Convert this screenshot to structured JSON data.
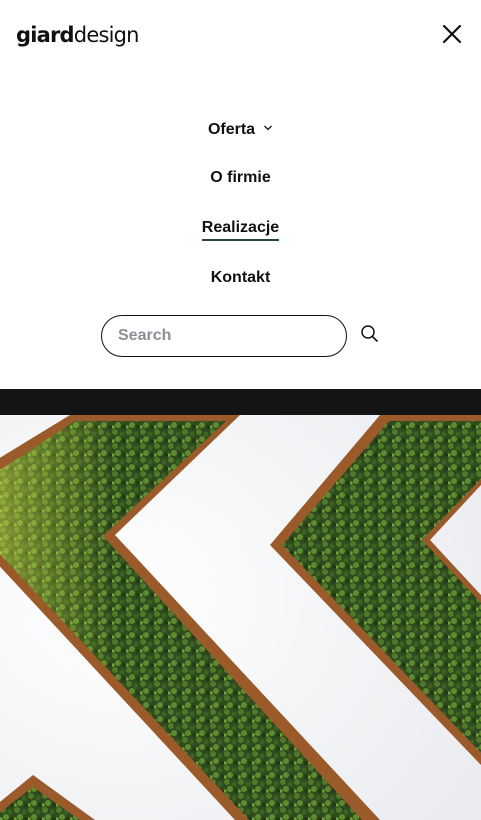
{
  "header": {
    "logo_bold": "giard",
    "logo_regular": "design",
    "close_icon": "close-icon"
  },
  "nav": {
    "items": [
      {
        "label": "Oferta",
        "has_dropdown": true,
        "active": false
      },
      {
        "label": "O firmie",
        "active": false
      },
      {
        "label": "Realizacje",
        "active": true
      },
      {
        "label": "Kontakt",
        "active": false
      }
    ],
    "dropdown_icon": "chevron-down-icon"
  },
  "search": {
    "placeholder": "Search",
    "value": "",
    "icon": "search-icon"
  },
  "colors": {
    "active_underline": "#1f4d2e",
    "dark_bar": "#141414",
    "text": "#111111",
    "placeholder": "#8b8f97"
  }
}
